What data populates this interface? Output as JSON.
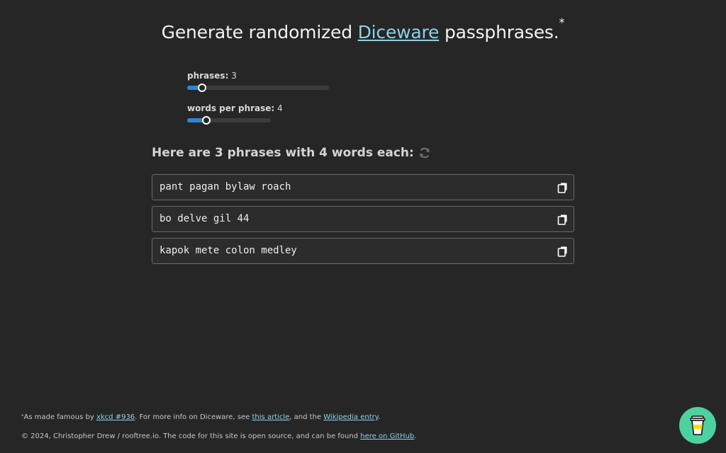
{
  "header": {
    "title_prefix": "Generate randomized ",
    "title_link": "Diceware",
    "title_suffix": " passphrases.",
    "title_marker": "*"
  },
  "controls": {
    "phrases": {
      "label": "phrases:",
      "value": "3",
      "min": 1,
      "max": 10,
      "current": 3,
      "fill_fraction": 0.105
    },
    "words_per_phrase": {
      "label": "words per phrase:",
      "value": "4",
      "min": 1,
      "max": 10,
      "current": 4,
      "fill_fraction": 0.23
    }
  },
  "results": {
    "heading": "Here are 3 phrases with 4 words each:",
    "refresh_icon": "refresh-icon",
    "copy_icon": "copy-icon",
    "phrases": [
      "pant pagan bylaw roach",
      "bo delve gil 44",
      "kapok mete colon medley"
    ]
  },
  "footer": {
    "marker": "*",
    "note_part1": "As made famous by ",
    "note_link1": "xkcd #936",
    "note_part2": ". For more info on Diceware, see ",
    "note_link2": "this article",
    "note_part3": ", and the ",
    "note_link3": "Wikipedia entry",
    "note_part4": ".",
    "copy_part1": "© 2024, Christopher Drew / rooftree.io. The code for this site is open source, and can be found ",
    "copy_link": "here on GitHub",
    "copy_part2": "."
  },
  "fab": {
    "icon": "coffee-cup-icon"
  },
  "colors": {
    "background": "#262626",
    "link": "#8ed0e6",
    "slider_fill": "#2f84d8",
    "fab": "#4ed1a0"
  }
}
